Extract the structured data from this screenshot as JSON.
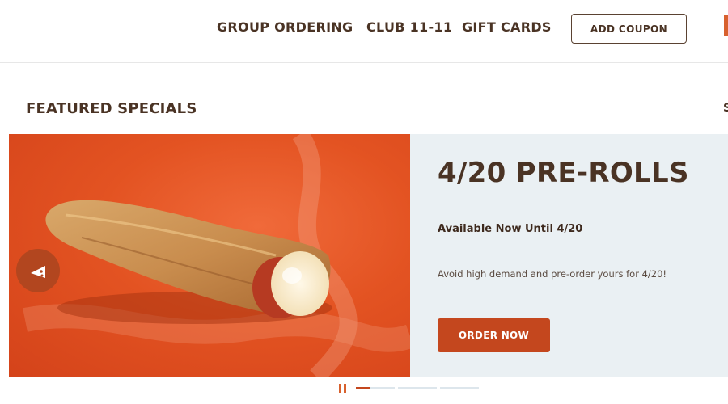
{
  "header": {
    "nav": [
      {
        "label": "GROUP ORDERING"
      },
      {
        "label": "CLUB 11-11"
      },
      {
        "label": "GIFT CARDS"
      }
    ],
    "coupon_label": "ADD COUPON"
  },
  "featured": {
    "title": "FEATURED SPECIALS",
    "edge_char": "S"
  },
  "slide": {
    "heading": "4/20 PRE-ROLLS",
    "subheading": "Available Now Until 4/20",
    "body": "Avoid high demand and pre-order yours for 4/20!",
    "cta_label": "ORDER NOW",
    "image_icon": "pizza-roll-image"
  },
  "carousel": {
    "slide_count": 4,
    "active_index": 0,
    "active_progress": 0.35
  },
  "colors": {
    "brand_brown": "#4a3324",
    "accent_orange": "#c4471e",
    "slide_bg": "#e35322",
    "panel_bg": "#eaf0f3"
  }
}
